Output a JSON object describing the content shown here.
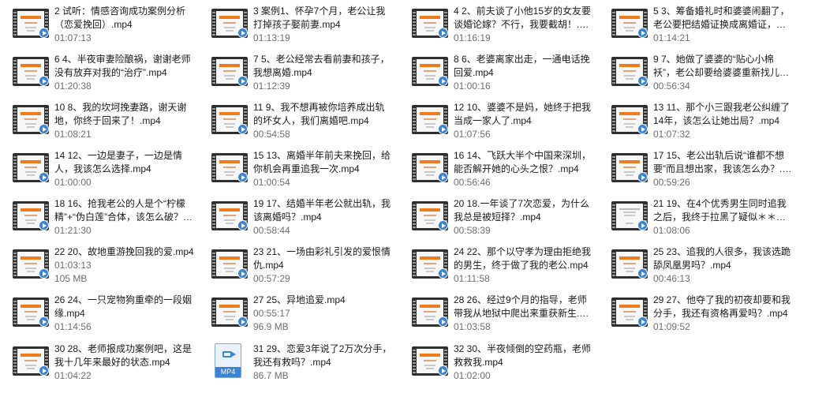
{
  "files": [
    {
      "name": "2 试听：情感咨询成功案例分析（恋爱挽回）.mp4",
      "meta": [
        "01:07:13"
      ],
      "thumb": "video-thumbnail"
    },
    {
      "name": "3 案例1、怀孕7个月，老公让我打掉孩子娶前妻.mp4",
      "meta": [
        "01:13:19"
      ],
      "thumb": "video-thumbnail"
    },
    {
      "name": "4 2、前夫谈了小他15岁的女友要谈婚论嫁？不行，我要截胡！.mp4",
      "meta": [
        "01:16:19"
      ],
      "thumb": "video-thumbnail"
    },
    {
      "name": "5 3、筹备婚礼时和婆婆闹翻了，老公要把结婚证换成离婚证，怎么…",
      "meta": [
        "01:14:21"
      ],
      "thumb": "video-thumbnail"
    },
    {
      "name": "6 4、半夜审妻险酿祸，谢谢老师没有放弃对我的“治疗”.mp4",
      "meta": [
        "01:20:38"
      ],
      "thumb": "video-thumbnail"
    },
    {
      "name": "7 5、老公经常去看前妻和孩子，我想离婚.mp4",
      "meta": [
        "01:12:39"
      ],
      "thumb": "video-thumbnail"
    },
    {
      "name": "8 6、老婆离家出走，一通电话挽回爱.mp4",
      "meta": [
        "01:00:16"
      ],
      "thumb": "video-thumbnail"
    },
    {
      "name": "9 7、她做了婆婆的“贴心小棉袄”，老公却要给婆婆重新找儿媳妇，w…",
      "meta": [
        "00:56:34"
      ],
      "thumb": "video-thumbnail"
    },
    {
      "name": "10 8、我的坎坷挽妻路，谢天谢地，你终于回来了！.mp4",
      "meta": [
        "01:08:21"
      ],
      "thumb": "video-thumbnail"
    },
    {
      "name": "11 9、我不想再被你培养成出轨的坏女人，我们离婚吧.mp4",
      "meta": [
        "00:54:58"
      ],
      "thumb": "video-thumbnail"
    },
    {
      "name": "12 10、婆婆不是妈，她终于把我当成一家人了.mp4",
      "meta": [
        "01:07:56"
      ],
      "thumb": "video-thumbnail"
    },
    {
      "name": "13 11、那个小三跟我老公纠缠了14年，该怎么让她出局？.mp4",
      "meta": [
        "01:07:32"
      ],
      "thumb": "video-thumbnail"
    },
    {
      "name": "14 12、一边是妻子，一边是情人，我该怎么选择.mp4",
      "meta": [
        "01:00:00"
      ],
      "thumb": "video-thumbnail"
    },
    {
      "name": "15 13、离婚半年前夫来挽回，给你机会再重追我一次.mp4",
      "meta": [
        "01:00:54"
      ],
      "thumb": "video-thumbnail"
    },
    {
      "name": "16 14、飞跃大半个中国来深圳，能否解开她的心头之恨？.mp4",
      "meta": [
        "00:56:46"
      ],
      "thumb": "video-thumbnail"
    },
    {
      "name": "17 15、老公出轨后说“谁都不想要”而且想出家，我该怎么办？.mp4",
      "meta": [
        "00:59:26"
      ],
      "thumb": "video-thumbnail"
    },
    {
      "name": "18 16、抢我老公的人是个“柠檬精”+“伪白莲”合体，该怎么破？.mp4",
      "meta": [
        "01:21:30"
      ],
      "thumb": "video-thumbnail"
    },
    {
      "name": "19 17、结婚半年老公就出轨，我该离婚吗？.mp4",
      "meta": [
        "00:58:44"
      ],
      "thumb": "video-thumbnail"
    },
    {
      "name": "20 18.一年谈了7次恋爱，为什么我总是被短择？.mp4",
      "meta": [
        "00:58:39"
      ],
      "thumb": "video-thumbnail"
    },
    {
      "name": "21 19、在4个优秀男生同时追我之后，我终于拉黑了疑似＊＊＊前…",
      "meta": [
        "01:08:06"
      ],
      "thumb": "video-thumbnail-alt"
    },
    {
      "name": "22 20、故地重游挽回我的爱.mp4",
      "meta": [
        "01:03:13",
        "105 MB"
      ],
      "thumb": "video-thumbnail"
    },
    {
      "name": "23 21、一场由彩礼引发的爱恨情仇.mp4",
      "meta": [
        "00:57:29"
      ],
      "thumb": "video-thumbnail"
    },
    {
      "name": "24 22、那个以守孝为理由拒绝我的男生，终于做了我的老公.mp4",
      "meta": [
        "01:11:58"
      ],
      "thumb": "video-thumbnail"
    },
    {
      "name": "25 23、追我的人很多，我该选跪舔凤凰男吗？.mp4",
      "meta": [
        "00:46:13"
      ],
      "thumb": "video-thumbnail"
    },
    {
      "name": "26 24、一只宠物狗重牵的一段姻缘.mp4",
      "meta": [
        "01:14:56"
      ],
      "thumb": "video-thumbnail"
    },
    {
      "name": "27 25、异地追爱.mp4",
      "meta": [
        "00:55:17",
        "96.9 MB"
      ],
      "thumb": "video-thumbnail"
    },
    {
      "name": "28 26、经过9个月的指导，老师带我从地狱中爬出来重获新生.mp4",
      "meta": [
        "01:03:58"
      ],
      "thumb": "video-thumbnail"
    },
    {
      "name": "29 27、他夺了我的初夜却要和我分手，我还有资格再爱吗？.mp4",
      "meta": [
        "01:09:52"
      ],
      "thumb": "video-thumbnail"
    },
    {
      "name": "30 28、老师报成功案例吧，这是我十几年来最好的状态.mp4",
      "meta": [
        "01:04:22"
      ],
      "thumb": "video-thumbnail"
    },
    {
      "name": "31 29、恋爱3年说了2万次分手，我还有救吗？.mp4",
      "meta": [
        "86.7 MB"
      ],
      "thumb": "mp4-file-icon",
      "badge": "MP4"
    },
    {
      "name": "32 30、半夜倾倒的空药瓶，老师救救我.mp4",
      "meta": [
        "01:02:00"
      ],
      "thumb": "video-thumbnail"
    }
  ]
}
